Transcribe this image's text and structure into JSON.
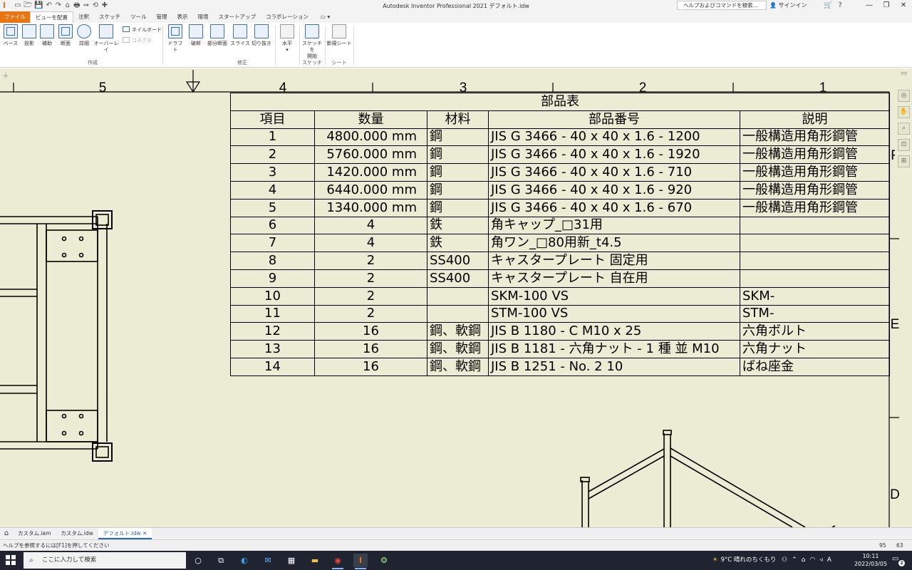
{
  "window": {
    "title": "Autodesk Inventor Professional 2021   デフォルト.idw",
    "help_search_placeholder": "ヘルプおよびコマンドを検索...",
    "signin_label": "サインイン",
    "controls": {
      "minimize": "—",
      "restore": "❐",
      "close": "✕"
    }
  },
  "quick_access": [
    "⌂",
    "▭",
    "🗁",
    "💾",
    "↶",
    "↷",
    "⌂",
    "🖶",
    "⇒",
    "⟲",
    "✚"
  ],
  "ribbon_tabs": [
    "ファイル",
    "ビューを配置",
    "注釈",
    "スケッチ",
    "ツール",
    "管理",
    "表示",
    "環境",
    "スタートアップ",
    "コラボレーション"
  ],
  "ribbon_tab_extra": "▭ ▾",
  "ribbon": {
    "create_buttons": [
      "ベース",
      "投影",
      "補助",
      "断面",
      "詳細",
      "オーバーレイ"
    ],
    "create_small": [
      {
        "label": "ネイルボード",
        "enabled": true
      },
      {
        "label": "コネクタ",
        "enabled": false
      }
    ],
    "create_group": "作成",
    "modify_buttons": [
      "ドラフト",
      "破断",
      "部分断面",
      "スライス",
      "切り抜き"
    ],
    "modify_group": "修正",
    "align_button": "水平",
    "align_arrow": "▾",
    "sketch_button_lines": [
      "スケッチを",
      "開始"
    ],
    "sketch_group": "スケッチ",
    "sheet_button": "新規シート",
    "sheet_group": "シート"
  },
  "drawing": {
    "column_zones": [
      "5",
      "4",
      "3",
      "2",
      "1"
    ],
    "row_zones": [
      "F",
      "E",
      "D"
    ]
  },
  "parts_list": {
    "title": "部品表",
    "headers": [
      "項目",
      "数量",
      "材料",
      "部品番号",
      "説明"
    ],
    "rows": [
      [
        "1",
        "4800.000 mm",
        "鋼",
        "JIS G 3466 - 40 x 40 x 1.6 - 1200",
        "一般構造用角形鋼管"
      ],
      [
        "2",
        "5760.000 mm",
        "鋼",
        "JIS G 3466 - 40 x 40 x 1.6 - 1920",
        "一般構造用角形鋼管"
      ],
      [
        "3",
        "1420.000 mm",
        "鋼",
        "JIS G 3466 - 40 x 40 x 1.6 - 710",
        "一般構造用角形鋼管"
      ],
      [
        "4",
        "6440.000 mm",
        "鋼",
        "JIS G 3466 - 40 x 40 x 1.6 - 920",
        "一般構造用角形鋼管"
      ],
      [
        "5",
        "1340.000 mm",
        "鋼",
        "JIS G 3466 - 40 x 40 x 1.6 - 670",
        "一般構造用角形鋼管"
      ],
      [
        "6",
        "4",
        "鉄",
        "角キャップ_□31用",
        ""
      ],
      [
        "7",
        "4",
        "鉄",
        "角ワン_□80用新_t4.5",
        ""
      ],
      [
        "8",
        "2",
        "SS400",
        "キャスタープレート 固定用",
        ""
      ],
      [
        "9",
        "2",
        "SS400",
        "キャスタープレート 自在用",
        ""
      ],
      [
        "10",
        "2",
        "",
        "SKM-100 VS",
        "SKM-"
      ],
      [
        "11",
        "2",
        "",
        "STM-100 VS",
        "STM-"
      ],
      [
        "12",
        "16",
        "鋼、軟鋼",
        "JIS B 1180 - C M10 x 25",
        "六角ボルト"
      ],
      [
        "13",
        "16",
        "鋼、軟鋼",
        "JIS B 1181 - 六角ナット - 1 種 並 M10",
        "六角ナット"
      ],
      [
        "14",
        "16",
        "鋼、軟鋼",
        "JIS B 1251 - No. 2 10",
        "ばね座金"
      ]
    ]
  },
  "document_tabs": [
    "カスタム.iam",
    "カスタム.idw",
    "デフォルト.idw"
  ],
  "active_document_tab": 2,
  "document_tab_close": "✕",
  "status": {
    "message": "ヘルプを参照するには[F1]を押してください",
    "value1": "95",
    "value2": "63"
  },
  "taskbar": {
    "search_placeholder": "ここに入力して検索",
    "weather": "9°C  晴れのちくもり",
    "time": "10:11",
    "date": "2022/03/05",
    "notifications": "2",
    "ime_label": "A"
  },
  "colors": {
    "sheet_background": "#ecebd3",
    "accent": "#e87511",
    "taskbar": "#1f2430"
  }
}
